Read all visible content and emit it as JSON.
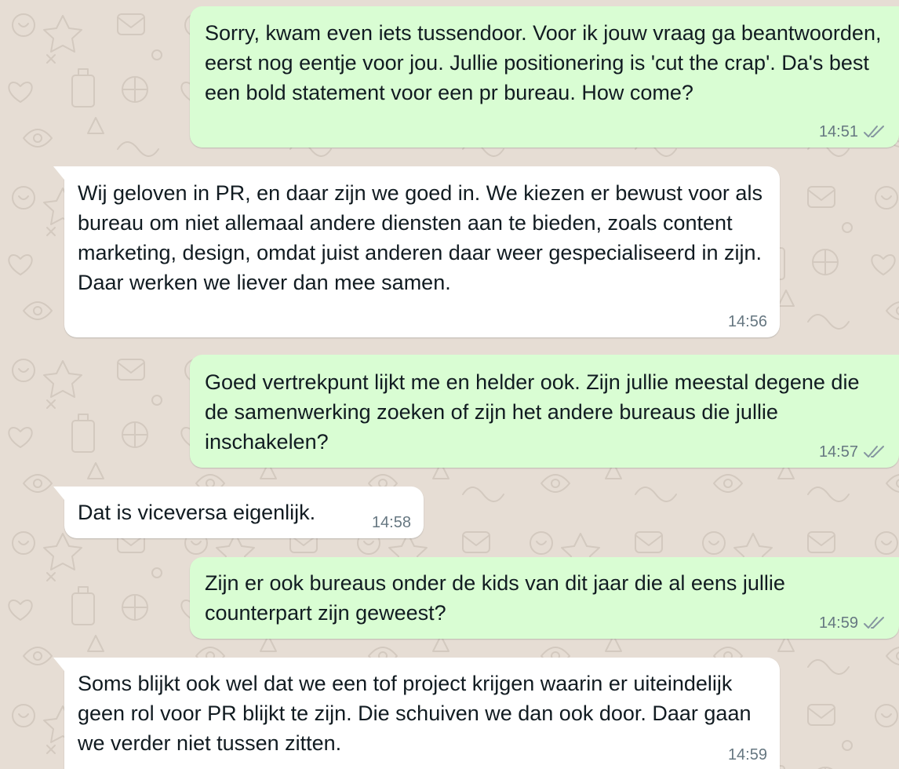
{
  "messages": [
    {
      "direction": "outgoing",
      "text": "Sorry, kwam even iets tussendoor. Voor ik jouw vraag ga beantwoorden, eerst nog eentje voor jou. Jullie positionering is 'cut the crap'. Da's best een bold statement voor een pr bureau. How come?",
      "time": "14:51",
      "status": "read"
    },
    {
      "direction": "incoming",
      "text": "Wij geloven in PR, en daar zijn we goed in. We kiezen er bewust voor als bureau om niet allemaal andere diensten aan te bieden, zoals content marketing, design, omdat juist anderen daar weer gespecialiseerd in zijn. Daar werken we liever dan mee samen.",
      "time": "14:56"
    },
    {
      "direction": "outgoing",
      "text": "Goed vertrekpunt lijkt me en helder ook. Zijn jullie meestal degene die de samenwerking zoeken of zijn het andere bureaus die jullie inschakelen?",
      "time": "14:57",
      "status": "read"
    },
    {
      "direction": "incoming",
      "text": "Dat is viceversa eigenlijk.",
      "time": "14:58"
    },
    {
      "direction": "outgoing",
      "text": "Zijn er ook bureaus onder de kids van dit jaar die al eens jullie counterpart zijn geweest?",
      "time": "14:59",
      "status": "read"
    },
    {
      "direction": "incoming",
      "text": "Soms blijkt ook wel dat we een tof project krijgen waarin er uiteindelijk geen rol voor PR blijkt te zijn. Die schuiven we dan ook door. Daar gaan we verder niet tussen zitten.",
      "time": "14:59"
    }
  ],
  "icons": {
    "read_receipt": "double-check-icon",
    "incoming_tail": "bubble-tail-icon"
  },
  "colors": {
    "chat_background": "#e6ddd4",
    "outgoing_bubble": "#d9fdd3",
    "incoming_bubble": "#ffffff",
    "message_text": "#111b21",
    "meta_text": "#667781"
  }
}
